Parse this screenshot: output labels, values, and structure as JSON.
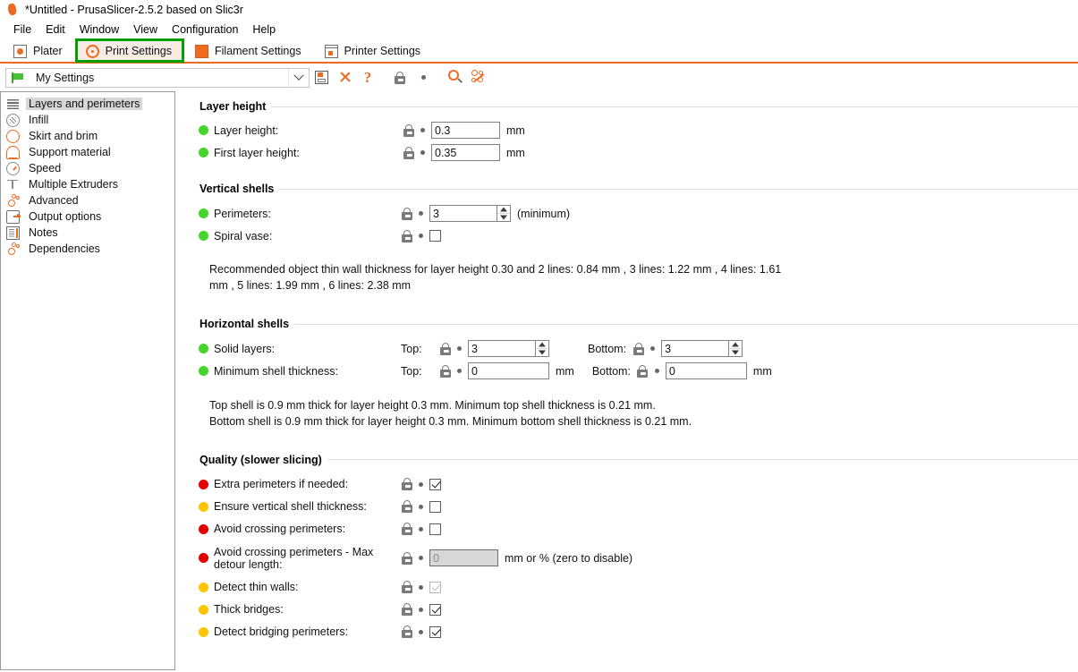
{
  "window": {
    "title": "*Untitled - PrusaSlicer-2.5.2 based on Slic3r",
    "logo_icon": "prusaslicer-logo-icon"
  },
  "menu": {
    "items": [
      {
        "label": "File"
      },
      {
        "label": "Edit"
      },
      {
        "label": "Window"
      },
      {
        "label": "View"
      },
      {
        "label": "Configuration"
      },
      {
        "label": "Help"
      }
    ]
  },
  "tabs": {
    "items": [
      {
        "label": "Plater",
        "icon": "plater-icon",
        "selected": false
      },
      {
        "label": "Print Settings",
        "icon": "print-settings-gear-icon",
        "selected": true,
        "annotated": true
      },
      {
        "label": "Filament Settings",
        "icon": "filament-spool-icon",
        "selected": false
      },
      {
        "label": "Printer Settings",
        "icon": "printer-icon",
        "selected": false
      }
    ],
    "annotation_color": "#00a000",
    "underline_color": "#ed6b21"
  },
  "preset_bar": {
    "flag_icon": "green-flag-icon",
    "preset_name": "My Settings",
    "dropdown_icon": "chevron-down-icon",
    "buttons": [
      {
        "name": "save-preset-button",
        "icon": "save-icon"
      },
      {
        "name": "delete-preset-button",
        "icon": "close-x-icon"
      },
      {
        "name": "help-button",
        "icon": "question-mark-icon"
      },
      {
        "name": "lock-toggle-button",
        "icon": "lock-icon"
      },
      {
        "name": "revert-dot-button",
        "icon": "dot-icon"
      },
      {
        "name": "search-button",
        "icon": "search-icon"
      },
      {
        "name": "compare-presets-button",
        "icon": "compare-presets-icon"
      }
    ]
  },
  "sidebar": {
    "items": [
      {
        "label": "Layers and perimeters",
        "icon": "layers-icon",
        "selected": true
      },
      {
        "label": "Infill",
        "icon": "infill-icon",
        "selected": false
      },
      {
        "label": "Skirt and brim",
        "icon": "skirt-brim-icon",
        "selected": false
      },
      {
        "label": "Support material",
        "icon": "support-material-icon",
        "selected": false
      },
      {
        "label": "Speed",
        "icon": "speed-clock-icon",
        "selected": false
      },
      {
        "label": "Multiple Extruders",
        "icon": "multiple-extruders-icon",
        "selected": false
      },
      {
        "label": "Advanced",
        "icon": "advanced-icon",
        "selected": false
      },
      {
        "label": "Output options",
        "icon": "output-options-icon",
        "selected": false
      },
      {
        "label": "Notes",
        "icon": "notes-icon",
        "selected": false
      },
      {
        "label": "Dependencies",
        "icon": "dependencies-icon",
        "selected": false
      }
    ]
  },
  "groups": {
    "layer_height": {
      "title": "Layer height",
      "rows": [
        {
          "label": "Layer height:",
          "status": "green",
          "value": "0.3",
          "unit": "mm"
        },
        {
          "label": "First layer height:",
          "status": "green",
          "value": "0.35",
          "unit": "mm"
        }
      ]
    },
    "vertical_shells": {
      "title": "Vertical shells",
      "perimeters": {
        "label": "Perimeters:",
        "status": "green",
        "value": "3",
        "unit": "(minimum)"
      },
      "spiral_vase": {
        "label": "Spiral vase:",
        "status": "green",
        "checked": false
      },
      "note": "Recommended object thin wall thickness for layer height 0.30 and 2 lines: 0.84 mm , 3 lines: 1.22 mm , 4 lines: 1.61 mm , 5 lines: 1.99 mm , 6 lines: 2.38 mm"
    },
    "horizontal_shells": {
      "title": "Horizontal shells",
      "solid_layers": {
        "label": "Solid layers:",
        "status": "green",
        "top_label": "Top:",
        "top_value": "3",
        "bottom_label": "Bottom:",
        "bottom_value": "3"
      },
      "min_shell_thickness": {
        "label": "Minimum shell thickness:",
        "status": "green",
        "top_label": "Top:",
        "top_value": "0",
        "top_unit": "mm",
        "bottom_label": "Bottom:",
        "bottom_value": "0",
        "bottom_unit": "mm"
      },
      "note_line1": "Top shell is 0.9 mm thick for layer height 0.3 mm. Minimum top shell thickness is 0.21 mm.",
      "note_line2": "Bottom shell is 0.9 mm thick for layer height 0.3 mm. Minimum bottom shell thickness is 0.21 mm."
    },
    "quality": {
      "title": "Quality (slower slicing)",
      "rows": [
        {
          "label": "Extra perimeters if needed:",
          "status": "red",
          "type": "checkbox",
          "checked": true,
          "disabled": false
        },
        {
          "label": "Ensure vertical shell thickness:",
          "status": "amber",
          "type": "checkbox",
          "checked": false,
          "disabled": false
        },
        {
          "label": "Avoid crossing perimeters:",
          "status": "red",
          "type": "checkbox",
          "checked": false,
          "disabled": false
        },
        {
          "label": "Avoid crossing perimeters - Max detour length:",
          "status": "red",
          "type": "text",
          "value": "0",
          "disabled": true,
          "unit": "mm or % (zero to disable)"
        },
        {
          "label": "Detect thin walls:",
          "status": "amber",
          "type": "checkbox",
          "checked": true,
          "disabled": true
        },
        {
          "label": "Thick bridges:",
          "status": "amber",
          "type": "checkbox",
          "checked": true,
          "disabled": false
        },
        {
          "label": "Detect bridging perimeters:",
          "status": "amber",
          "type": "checkbox",
          "checked": true,
          "disabled": false
        }
      ]
    }
  },
  "colors": {
    "accent": "#ed6b21",
    "status_green": "#44d62c",
    "status_red": "#e10000",
    "status_amber": "#ffc400",
    "annotation_green": "#00a000"
  }
}
